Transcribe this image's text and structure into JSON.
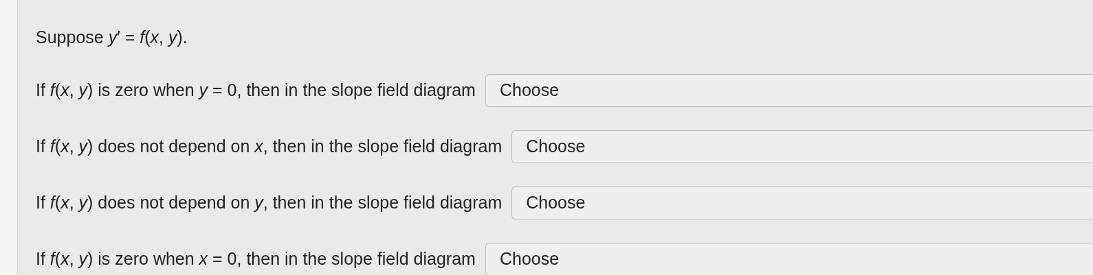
{
  "intro": "Suppose *y*′ = *f*(*x*, *y*).",
  "questions": [
    {
      "text": "If *f*(*x*, *y*) is zero when *y* = 0, then in the slope field diagram",
      "select": "Choose"
    },
    {
      "text": "If *f*(*x*, *y*) does not depend on *x*, then in the slope field diagram",
      "select": "Choose"
    },
    {
      "text": "If *f*(*x*, *y*) does not depend on *y*, then in the slope field diagram",
      "select": "Choose"
    },
    {
      "text": "If *f*(*x*, *y*) is zero when *x* = 0, then in the slope field diagram",
      "select": "Choose"
    }
  ]
}
